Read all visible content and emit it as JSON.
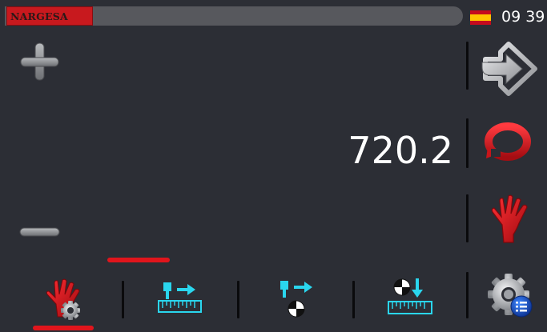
{
  "header": {
    "brand": "NARGESA",
    "language_flag_icon": "spain-flag-icon",
    "time": "09 39"
  },
  "main": {
    "value": "720.2"
  },
  "controls": {
    "increase_icon": "plus-icon",
    "decrease_icon": "minus-icon",
    "start_icon": "arrow-right-diamond-icon",
    "cycle_icon": "rotate-cycle-icon",
    "manual_icon": "hand-icon"
  },
  "bottom_tabs": [
    {
      "icon": "manual-settings-icon",
      "active": true
    },
    {
      "icon": "backgauge-move-icon"
    },
    {
      "icon": "backgauge-reference-icon"
    },
    {
      "icon": "reference-measure-icon"
    }
  ],
  "settings_icon": "settings-gear-icon",
  "colors": {
    "background": "#2c2e35",
    "accent_red": "#e1151c",
    "cyan": "#2ad6ee",
    "header_bar": "#57585d"
  }
}
